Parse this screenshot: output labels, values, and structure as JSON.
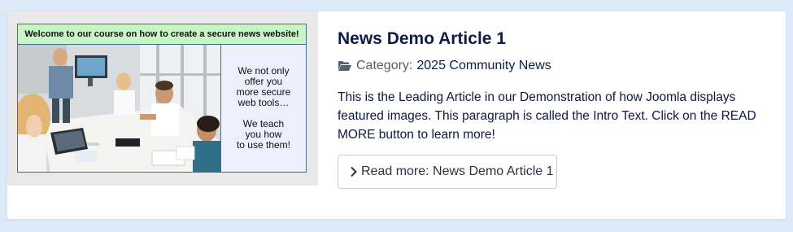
{
  "image": {
    "banner": "Welcome to our course on how to create a secure news website!",
    "note_lines_1": [
      "We not only",
      "offer you",
      "more secure",
      "web tools…"
    ],
    "note_lines_2": [
      "We teach",
      "you how",
      "to use them!"
    ],
    "photo_icon": "team-meeting-photo"
  },
  "article": {
    "title": "News Demo Article 1",
    "category_prefix": "Category:",
    "category_name": "2025 Community News",
    "category_icon": "folder-open-icon",
    "intro": "This is the Leading Article in our Demonstration of how Joomla displays featured images. This paragraph is called the Intro Text. Click on the READ MORE button to learn more!",
    "readmore_label": "Read more: News Demo Article 1",
    "readmore_icon": "chevron-right-icon"
  },
  "colors": {
    "page_bg": "#dce9f8",
    "title": "#0e1c4b",
    "banner_bg": "#c8f5c5",
    "note_bg": "#eeeefc"
  }
}
